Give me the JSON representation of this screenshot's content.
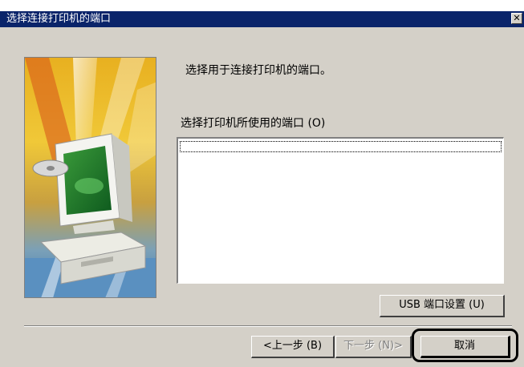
{
  "window": {
    "title": "选择连接打印机的端口",
    "close_glyph": "✕"
  },
  "main": {
    "instruction": "选择用于连接打印机的端口。",
    "port_list_label": "选择打印机所使用的端口 (O)",
    "port_items": []
  },
  "buttons": {
    "usb_settings": "USB 端口设置 (U)",
    "back": "<上一步 (B)",
    "next": "下一步 (N)>",
    "cancel": "取消"
  },
  "icons": {
    "banner": "computer-monitor-printer-illustration",
    "close": "close-icon"
  }
}
